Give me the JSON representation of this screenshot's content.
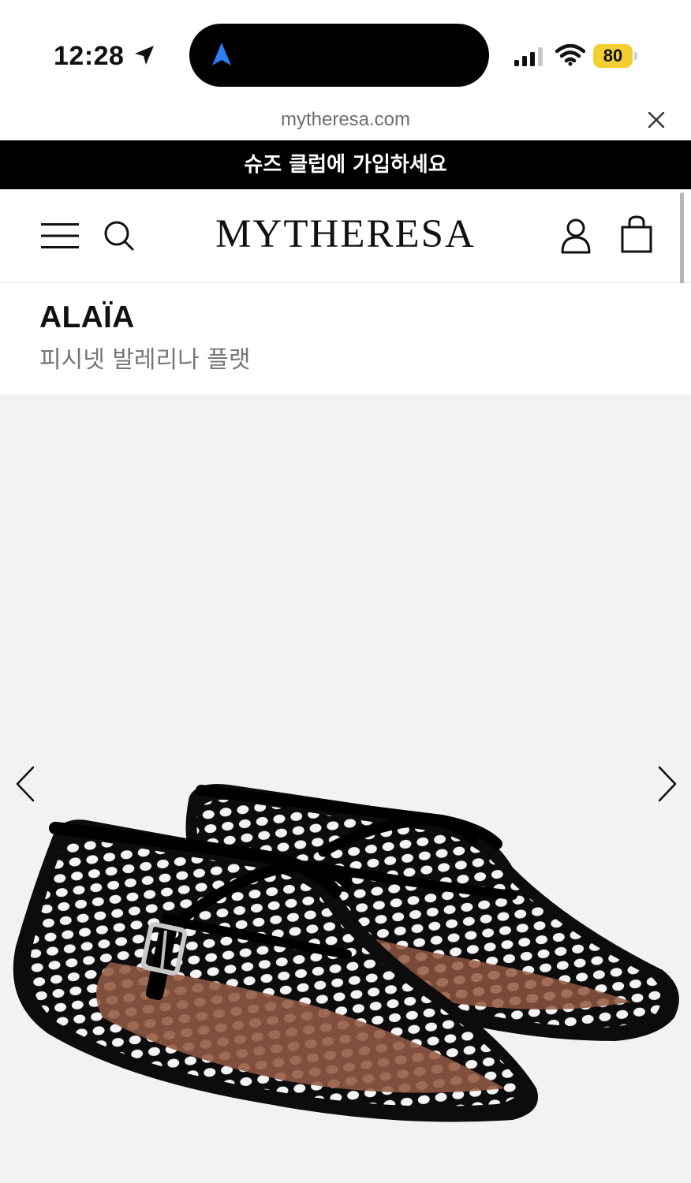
{
  "status_bar": {
    "time": "12:28",
    "battery": "80",
    "battery_color": "#f2cf30",
    "nav_icon_color": "#2f7bf6"
  },
  "browser": {
    "url": "mytheresa.com"
  },
  "promo_banner": {
    "text": "슈즈 클럽에 가입하세요"
  },
  "header": {
    "logo": "MYTHERESA"
  },
  "product": {
    "brand": "ALAÏA",
    "name": "피시넷 발레리나 플랫"
  },
  "gallery": {
    "background": "#f2f2f2"
  }
}
